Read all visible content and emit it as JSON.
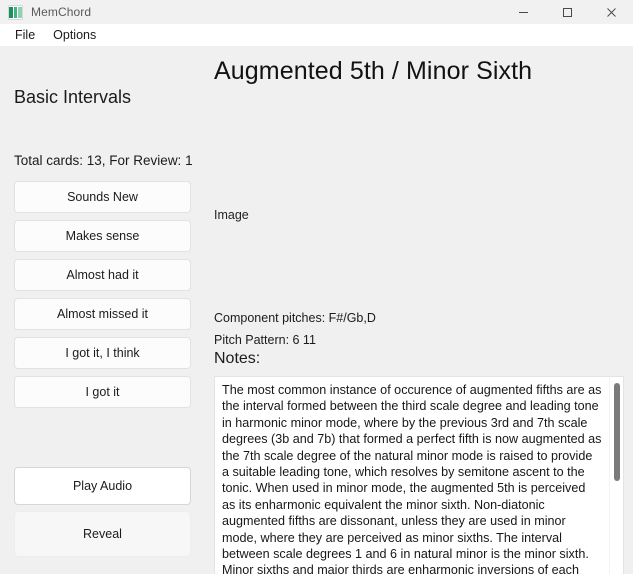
{
  "window": {
    "title": "MemChord",
    "icon": "app-icon",
    "controls": {
      "minimize": "minimize-icon",
      "maximize": "maximize-icon",
      "close": "close-icon"
    }
  },
  "menubar": {
    "items": [
      {
        "label": "File"
      },
      {
        "label": "Options"
      }
    ]
  },
  "sidebar": {
    "deck_title": "Basic Intervals",
    "stats": "Total cards: 13, For Review: 1",
    "rating_buttons": [
      {
        "label": "Sounds New"
      },
      {
        "label": "Makes sense"
      },
      {
        "label": "Almost had it"
      },
      {
        "label": "Almost missed it"
      },
      {
        "label": "I got it, I think"
      },
      {
        "label": "I got it"
      }
    ],
    "play_audio_label": "Play Audio",
    "reveal_label": "Reveal"
  },
  "card": {
    "title": "Augmented 5th / Minor Sixth",
    "image_label": "Image",
    "component_pitches": "Component pitches: F#/Gb,D",
    "pitch_pattern": "Pitch Pattern: 6 11",
    "notes_label": "Notes:",
    "notes_text": "The most common instance of occurence of augmented fifths are as the interval formed between the third scale degree and leading tone in harmonic minor mode, where by the previous 3rd and 7th scale degrees (3b and 7b) that formed a perfect fifth is now augmented as the 7th scale degree of the natural minor mode is raised to provide a suitable leading tone, which resolves by semitone ascent to the tonic. When used in minor mode, the augmented 5th is perceived as its enharmonic equivalent the minor sixth. Non-diatonic augmented fifths are dissonant, unless they are used in minor mode, where they are perceived as minor sixths. The interval between scale degrees 1 and 6 in natural minor is the minor sixth. Minor sixths and major thirds are enharmonic inversions of each other."
  },
  "colors": {
    "window_background": "#f0f0f0",
    "titlebar": "#f1f1f1",
    "menubar": "#ffffff",
    "button_face": "#fcfcfc",
    "notes_background": "#ffffff",
    "scroll_thumb": "#7a7a7a",
    "icon_green": "#1c8f5e"
  }
}
